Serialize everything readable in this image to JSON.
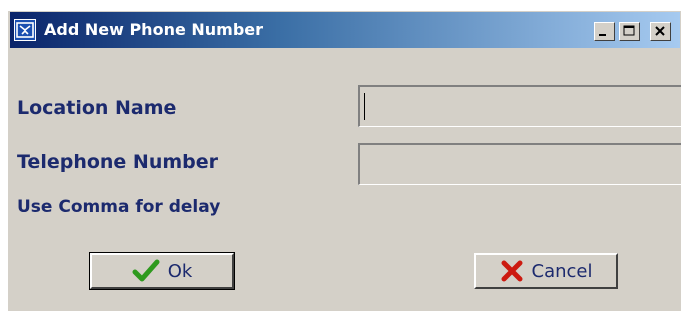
{
  "window": {
    "title": "Add New Phone Number",
    "controls": {
      "minimize_icon": "minimize-icon",
      "maximize_icon": "maximize-icon",
      "close_icon": "close-icon"
    }
  },
  "form": {
    "location_label": "Location Name",
    "location_value": "",
    "phone_label": "Telephone Number",
    "phone_value": "",
    "hint": "Use Comma for delay"
  },
  "buttons": {
    "ok_label": "Ok",
    "ok_icon": "checkmark-icon",
    "cancel_label": "Cancel",
    "cancel_icon": "x-mark-icon"
  },
  "colors": {
    "title_gradient_start": "#0a246a",
    "title_gradient_end": "#a6caf0",
    "label_color": "#1c2a6e",
    "ok_icon_color": "#2e9a1e",
    "cancel_icon_color": "#cc1a10"
  }
}
